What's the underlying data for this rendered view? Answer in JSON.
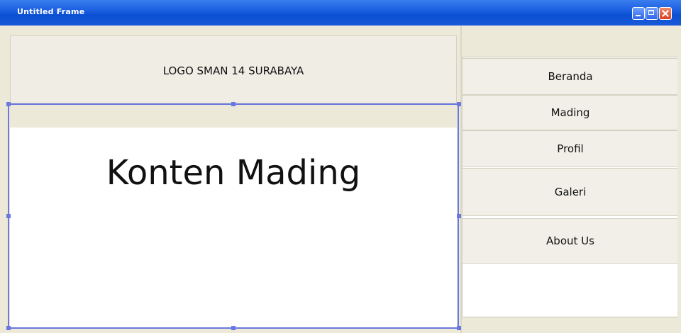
{
  "window": {
    "title": "Untitled Frame",
    "colors": {
      "titlebar": "#0a4fd2",
      "selection": "#6a78e0",
      "frame": "#ece9d8"
    },
    "controls": [
      "minimize-icon",
      "maximize-icon",
      "close-icon"
    ]
  },
  "header": {
    "logo_text": "LOGO SMAN 14 SURABAYA"
  },
  "main": {
    "content_title": "Konten Mading"
  },
  "nav": {
    "items": [
      {
        "label": "Beranda"
      },
      {
        "label": "Mading"
      },
      {
        "label": "Profil"
      },
      {
        "label": "Galeri"
      },
      {
        "label": "About Us"
      }
    ]
  }
}
